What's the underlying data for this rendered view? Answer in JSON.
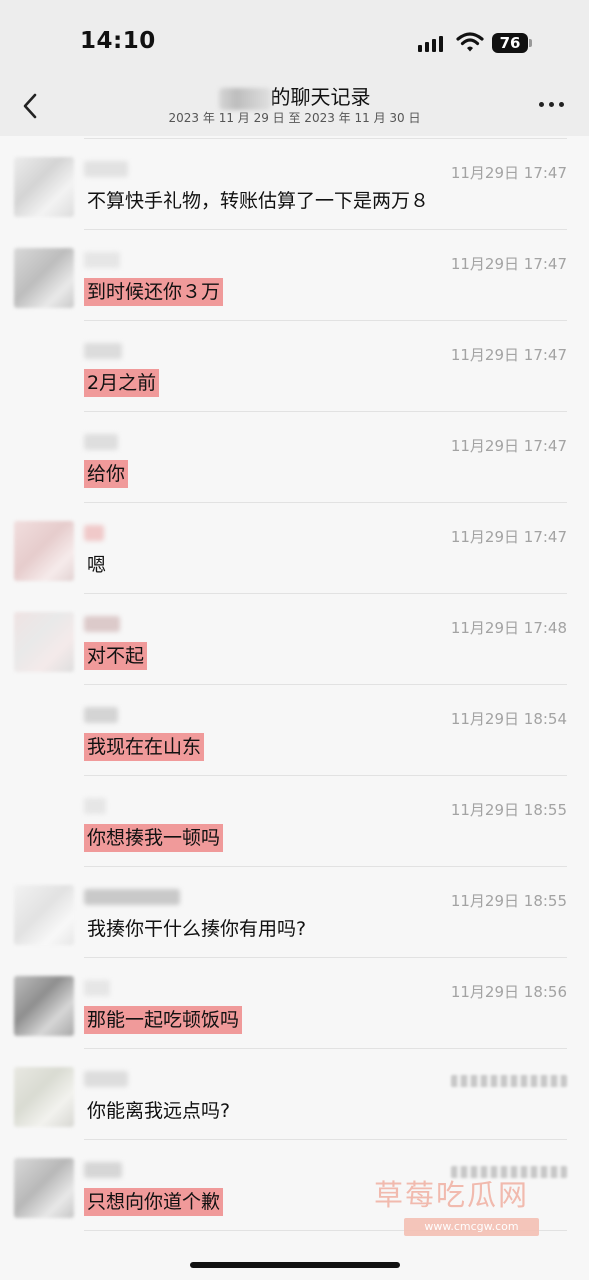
{
  "status_bar": {
    "time": "14:10",
    "battery": "76",
    "icons": [
      "signal-icon",
      "wifi-icon",
      "battery-icon"
    ]
  },
  "nav": {
    "title_suffix": "的聊天记录",
    "subtitle": "2023 年 11 月 29 日 至 2023 年 11 月 30 日",
    "icons": [
      "back-chevron-icon",
      "more-dots-icon"
    ]
  },
  "messages": [
    {
      "time": "11月29日 17:47",
      "text": "不算快手礼物，转账估算了一下是两万８",
      "highlight": false
    },
    {
      "time": "11月29日 17:47",
      "text": "到时候还你３万",
      "highlight": true
    },
    {
      "time": "11月29日 17:47",
      "text": "2月之前",
      "highlight": true
    },
    {
      "time": "11月29日 17:47",
      "text": "给你",
      "highlight": true
    },
    {
      "time": "11月29日 17:47",
      "text": "嗯",
      "highlight": false
    },
    {
      "time": "11月29日 17:48",
      "text": "对不起",
      "highlight": true
    },
    {
      "time": "11月29日 18:54",
      "text": "我现在在山东",
      "highlight": true
    },
    {
      "time": "11月29日 18:55",
      "text": "你想揍我一顿吗",
      "highlight": true
    },
    {
      "time": "11月29日 18:55",
      "text": "我揍你干什么揍你有用吗?",
      "highlight": false
    },
    {
      "time": "11月29日 18:56",
      "text": "那能一起吃顿饭吗",
      "highlight": true
    },
    {
      "time": "",
      "text": "你能离我远点吗?",
      "highlight": false
    },
    {
      "time": "",
      "text": "只想向你道个歉",
      "highlight": true
    }
  ],
  "watermark": {
    "main": "草莓吃瓜网",
    "sub": "www.cmcgw.com"
  },
  "colors": {
    "highlight": "#f09a9a",
    "timestamp": "#a3a3a3",
    "header_bg": "#ededed"
  }
}
